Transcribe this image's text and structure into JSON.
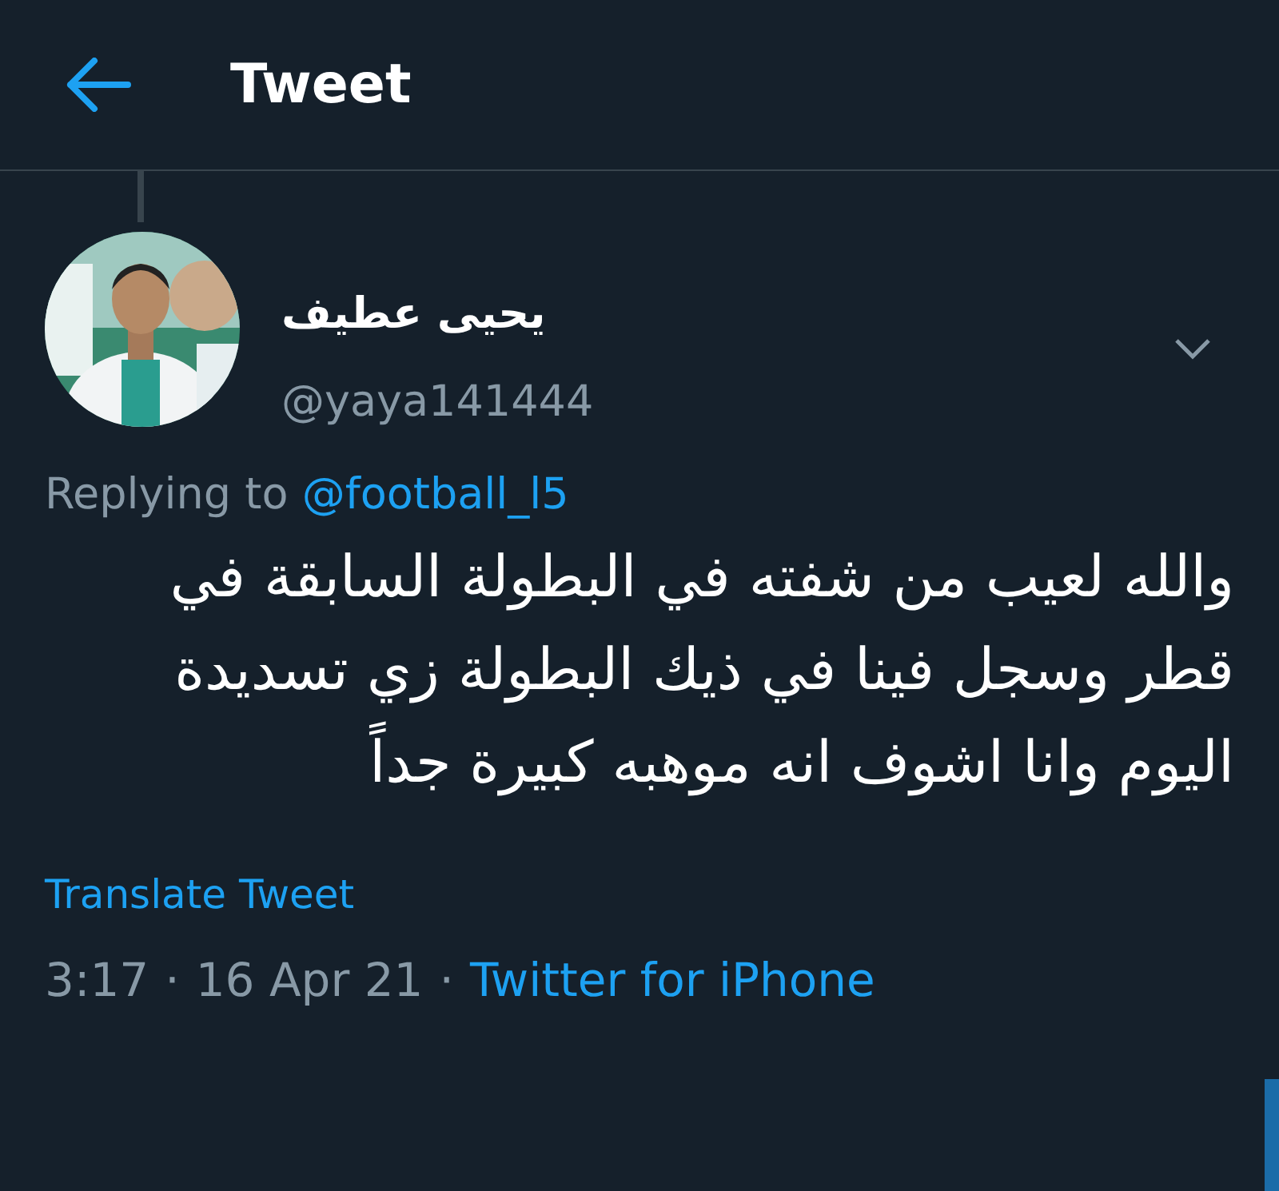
{
  "header": {
    "title": "Tweet"
  },
  "tweet": {
    "author_name": "يحيى عطيف",
    "handle": "@yaya141444",
    "replying_label": "Replying to",
    "replying_to": "@football_l5",
    "text": "والله لعيب من شفته في البطولة السابقة في قطر وسجل فينا في ذيك البطولة زي تسديدة اليوم وانا اشوف انه موهبه كبيرة جداً",
    "translate": "Translate Tweet",
    "time": "3:17",
    "date": "16 Apr 21",
    "separator": "·",
    "source": "Twitter for iPhone"
  }
}
